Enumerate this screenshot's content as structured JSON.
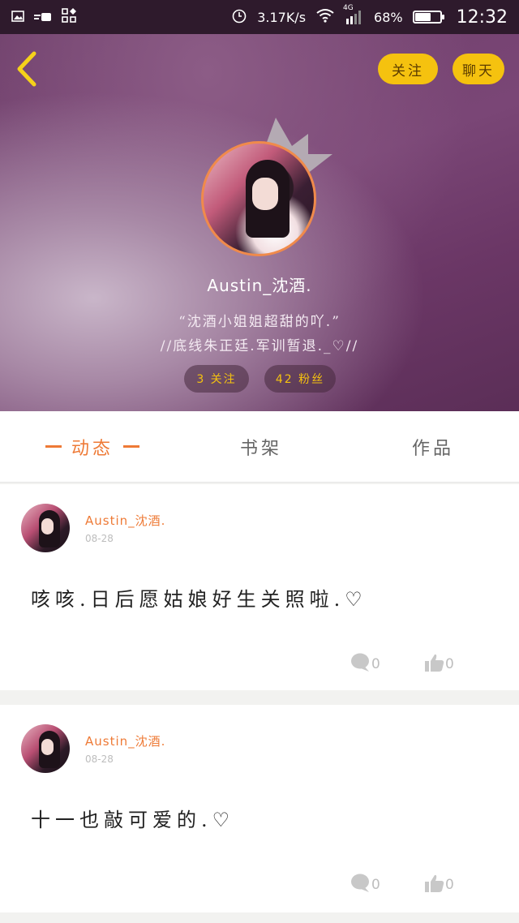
{
  "status_bar": {
    "network_speed": "3.17K/s",
    "network_type": "4G",
    "battery_percent": "68%",
    "battery_level": 0.68,
    "time": "12:32"
  },
  "header": {
    "follow_label": "关注",
    "chat_label": "聊天",
    "username": "Austin_沈酒.",
    "bio_line1": "“沈酒小姐姐超甜的吖.”",
    "bio_line2": "//底线朱正廷.军训暂退._♡//",
    "following_stat": "3 关注",
    "fans_stat": "42 粉丝"
  },
  "tabs": [
    {
      "label": "动态",
      "active": true
    },
    {
      "label": "书架",
      "active": false
    },
    {
      "label": "作品",
      "active": false
    }
  ],
  "posts": [
    {
      "user": "Austin_沈酒.",
      "date": "08-28",
      "text": "咳咳.日后愿姑娘好生关照啦.♡",
      "comments": "0",
      "likes": "0"
    },
    {
      "user": "Austin_沈酒.",
      "date": "08-28",
      "text": "十一也敲可爱的.♡",
      "comments": "0",
      "likes": "0"
    }
  ],
  "colors": {
    "accent": "#ee7a36",
    "yellow": "#f5c20f",
    "status_bar": "#2e1a2c"
  },
  "icons": [
    "image-icon",
    "message-icon",
    "grid-icon",
    "alarm-icon",
    "wifi-icon",
    "signal-icon",
    "battery-icon",
    "back-icon",
    "crown-icon",
    "comment-icon",
    "like-icon"
  ]
}
